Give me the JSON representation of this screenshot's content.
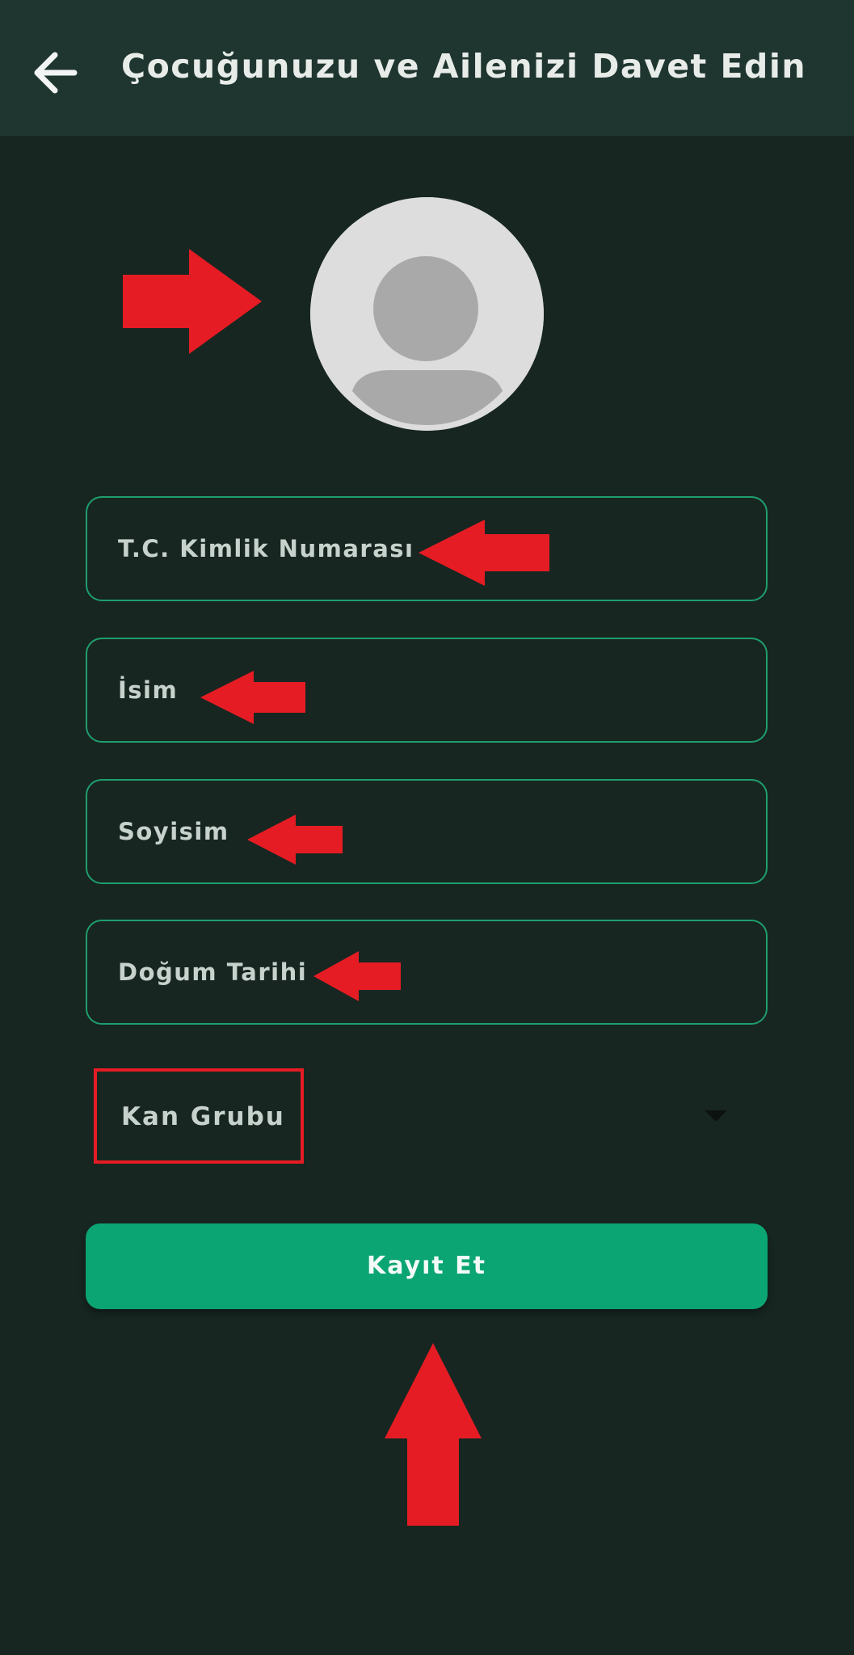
{
  "header": {
    "title": "Çocuğunuzu ve Ailenizi Davet Edin",
    "back_icon": "arrow-left-icon"
  },
  "avatar": {
    "icon": "user-placeholder-icon"
  },
  "form": {
    "fields": [
      {
        "label": "T.C. Kimlik Numarası"
      },
      {
        "label": "İsim"
      },
      {
        "label": "Soyisim"
      },
      {
        "label": "Doğum Tarihi"
      }
    ],
    "blood_group": {
      "label": "Kan Grubu",
      "icon": "caret-down-icon"
    },
    "submit_label": "Kayıt Et"
  },
  "annotations": {
    "color": "#e61c24"
  },
  "colors": {
    "background": "#172621",
    "appbar": "#1f3630",
    "field_border": "#1f9e6e",
    "button": "#0ba573"
  }
}
